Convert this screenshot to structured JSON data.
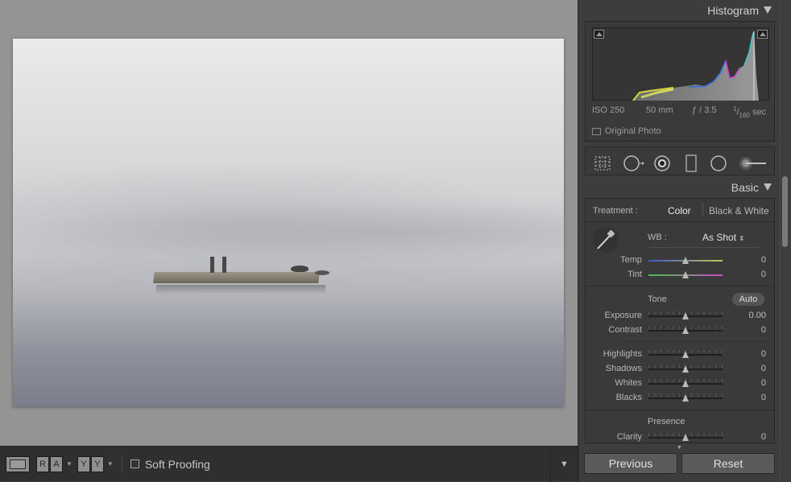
{
  "toolbar": {
    "split_left": "R|A",
    "split_right": "Y|Y",
    "soft_proofing_label": "Soft Proofing"
  },
  "histogram": {
    "title": "Histogram",
    "iso": "ISO 250",
    "focal": "50 mm",
    "aperture": "ƒ / 3.5",
    "shutter_num": "1",
    "shutter_den": "160",
    "shutter_unit": "sec",
    "original_photo_label": "Original Photo"
  },
  "basic": {
    "title": "Basic",
    "treatment_label": "Treatment :",
    "treatment_color": "Color",
    "treatment_bw": "Black & White",
    "wb_label": "WB :",
    "wb_value": "As Shot",
    "temp_label": "Temp",
    "temp_value": "0",
    "tint_label": "Tint",
    "tint_value": "0",
    "tone_label": "Tone",
    "auto_label": "Auto",
    "exposure_label": "Exposure",
    "exposure_value": "0.00",
    "contrast_label": "Contrast",
    "contrast_value": "0",
    "highlights_label": "Highlights",
    "highlights_value": "0",
    "shadows_label": "Shadows",
    "shadows_value": "0",
    "whites_label": "Whites",
    "whites_value": "0",
    "blacks_label": "Blacks",
    "blacks_value": "0",
    "presence_label": "Presence",
    "clarity_label": "Clarity",
    "clarity_value": "0"
  },
  "buttons": {
    "previous": "Previous",
    "reset": "Reset"
  },
  "colors": {
    "accent_temp_left": "#3a55c8",
    "accent_temp_right": "#c6c653",
    "accent_tint_left": "#4cc04c",
    "accent_tint_right": "#c84cc8"
  },
  "icons": [
    "crop-icon",
    "spot-removal-icon",
    "red-eye-icon",
    "graduated-filter-icon",
    "radial-filter-icon",
    "adjustment-brush-icon",
    "eyedropper-icon"
  ]
}
